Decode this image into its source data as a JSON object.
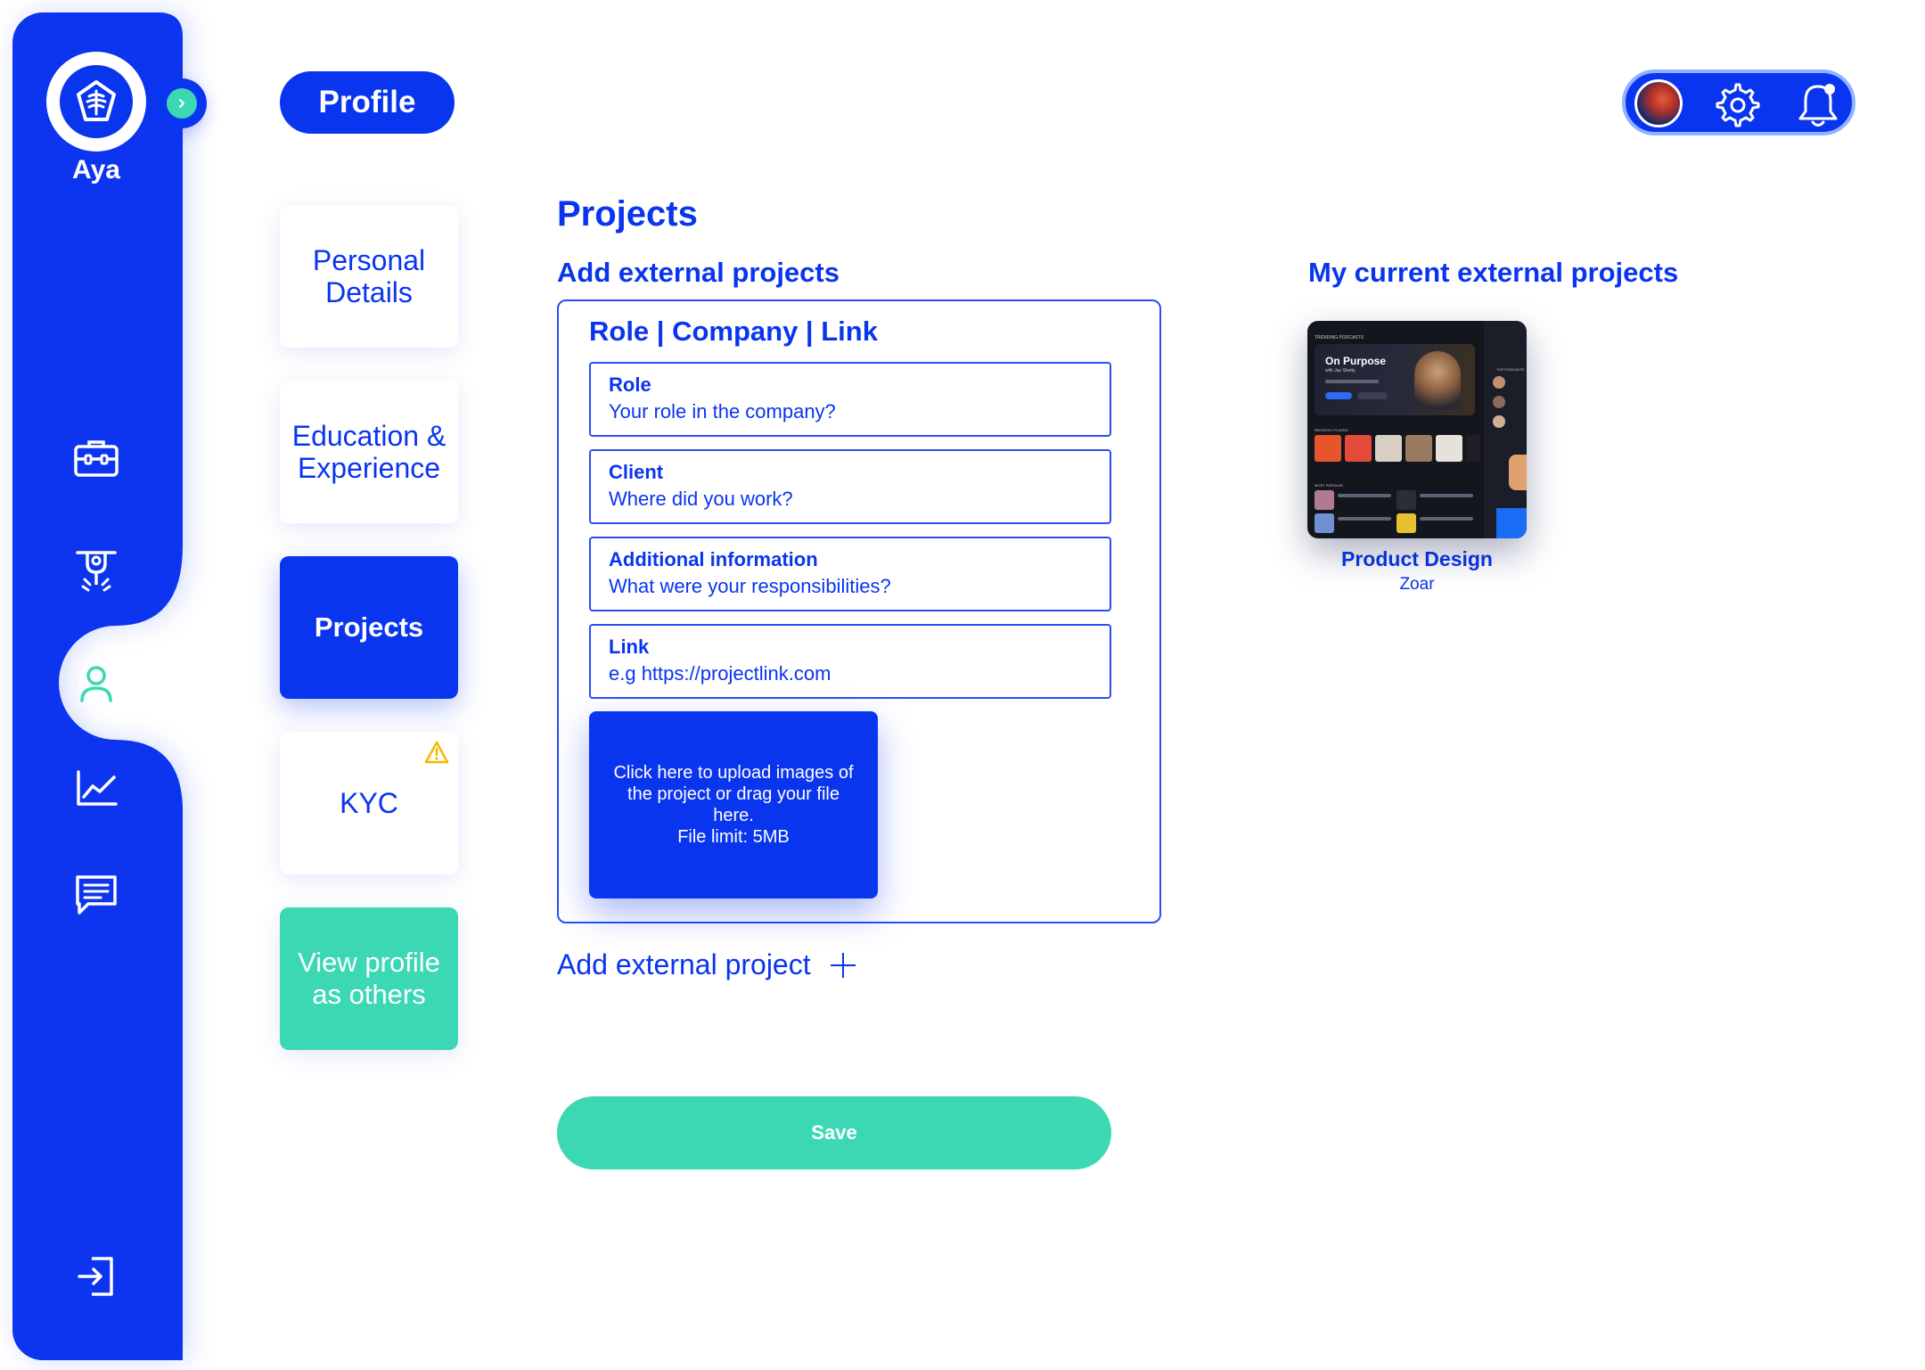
{
  "app": {
    "brand_name": "Aya"
  },
  "header": {
    "page_title": "Profile"
  },
  "sidebar": {
    "items": [
      {
        "icon": "briefcase-icon"
      },
      {
        "icon": "tools-icon"
      },
      {
        "icon": "user-icon",
        "active": true
      },
      {
        "icon": "chart-line-icon"
      },
      {
        "icon": "message-icon"
      }
    ],
    "logout_icon": "logout-icon"
  },
  "tabs": [
    {
      "label": "Personal Details"
    },
    {
      "label": "Education & Experience"
    },
    {
      "label": "Projects",
      "active": true
    },
    {
      "label": "KYC",
      "warning": true
    },
    {
      "label": "View profile as others"
    }
  ],
  "main": {
    "section_title": "Projects",
    "add_title": "Add external projects",
    "current_title": "My current external projects",
    "form": {
      "card_title": "Role | Company | Link",
      "fields": [
        {
          "label": "Role",
          "placeholder": "Your role in the company?",
          "value": ""
        },
        {
          "label": "Client",
          "placeholder": "Where did you work?",
          "value": ""
        },
        {
          "label": "Additional information",
          "placeholder": "What were your responsibilities?",
          "value": ""
        },
        {
          "label": "Link",
          "placeholder": "e.g https://projectlink.com",
          "value": ""
        }
      ],
      "upload": {
        "line1": "Click here to upload images of the project or drag your file here.",
        "line2": "File limit: 5MB"
      }
    },
    "add_project_label": "Add external project",
    "save_label": "Save",
    "projects": [
      {
        "name": "Product Design",
        "company": "Zoar",
        "thumbnail": {
          "header": "TRENDING PODCASTS",
          "title": "On Purpose",
          "subtitle": "with Jay Shetty",
          "recent_label": "RECENTLY PLAYED",
          "popular_label": "MOST POPULAR",
          "quick_label": "QUICK SEARCH",
          "top_label": "TOP PODCASTS"
        }
      }
    ]
  },
  "colors": {
    "primary": "#0a35ef",
    "accent": "#3cd8b4",
    "warning": "#f5b800"
  }
}
